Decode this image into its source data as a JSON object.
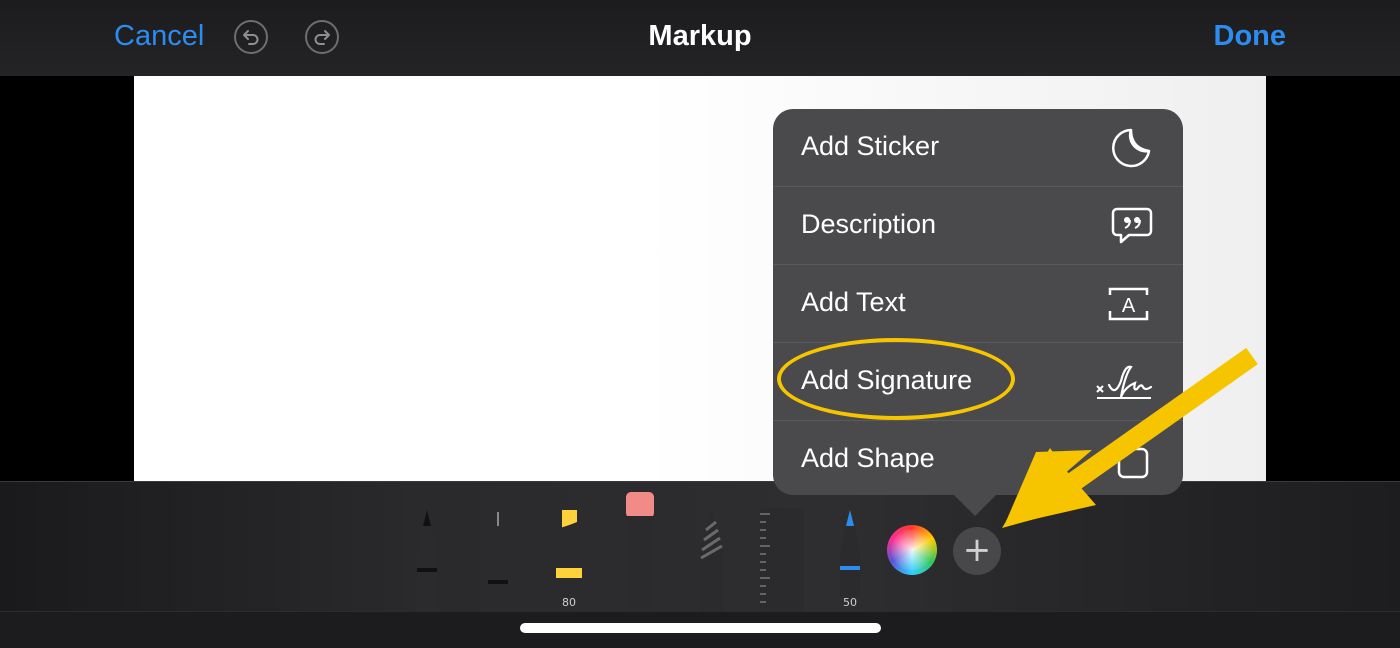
{
  "header": {
    "cancel_label": "Cancel",
    "title": "Markup",
    "done_label": "Done"
  },
  "menu": {
    "items": [
      {
        "label": "Add Sticker",
        "icon": "sticker-icon"
      },
      {
        "label": "Description",
        "icon": "quote-bubble-icon"
      },
      {
        "label": "Add Text",
        "icon": "text-box-icon"
      },
      {
        "label": "Add Signature",
        "icon": "signature-icon"
      },
      {
        "label": "Add Shape",
        "icon": "square-icon"
      }
    ]
  },
  "tools": [
    {
      "name": "pen",
      "label": ""
    },
    {
      "name": "fineliner",
      "label": ""
    },
    {
      "name": "highlighter",
      "label": "80"
    },
    {
      "name": "eraser",
      "label": ""
    },
    {
      "name": "lasso",
      "label": ""
    },
    {
      "name": "ruler",
      "label": ""
    },
    {
      "name": "pencil",
      "label": "50"
    }
  ],
  "colors": {
    "accent": "#2d8cf0",
    "highlight": "#f7c400",
    "popover_bg": "#4a4a4c"
  }
}
